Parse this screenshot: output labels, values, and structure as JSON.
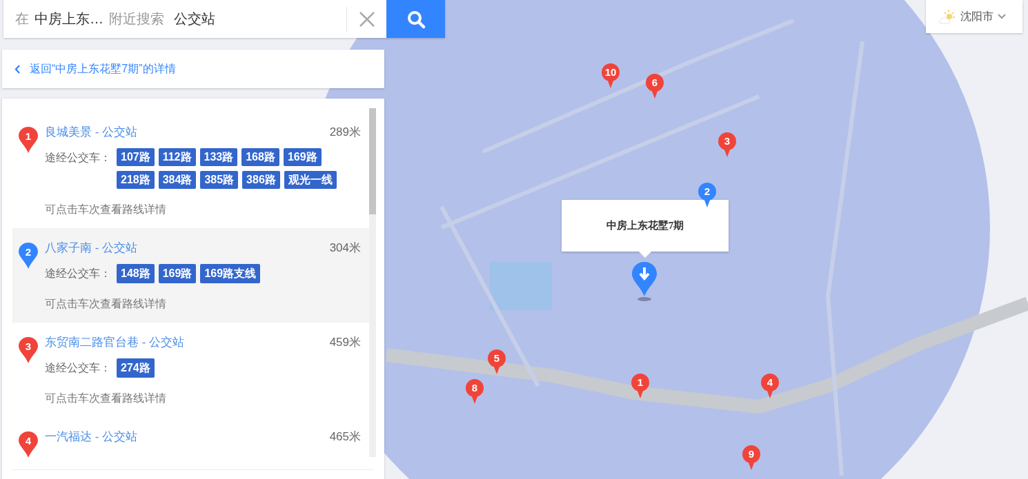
{
  "search": {
    "prefix": "在",
    "place": "中房上东…",
    "suffix": "附近搜索",
    "value": "公交站"
  },
  "back_link": "返回“中房上东花墅7期”的详情",
  "results": [
    {
      "index": "1",
      "name": "良城美景 - 公交站",
      "distance": "289米",
      "routes_label": "途经公交车：",
      "routes": [
        "107路",
        "112路",
        "133路",
        "168路",
        "169路",
        "218路",
        "384路",
        "385路",
        "386路",
        "观光一线"
      ],
      "hint": "可点击车次查看路线详情",
      "selected": false
    },
    {
      "index": "2",
      "name": "八家子南 - 公交站",
      "distance": "304米",
      "routes_label": "途经公交车：",
      "routes": [
        "148路",
        "169路",
        "169路支线"
      ],
      "hint": "可点击车次查看路线详情",
      "selected": true
    },
    {
      "index": "3",
      "name": "东贸南二路官台巷 - 公交站",
      "distance": "459米",
      "routes_label": "途经公交车：",
      "routes": [
        "274路"
      ],
      "hint": "可点击车次查看路线详情",
      "selected": false
    },
    {
      "index": "4",
      "name": "一汽福达 - 公交站",
      "distance": "465米",
      "selected": false
    }
  ],
  "city": "沈阳市",
  "map": {
    "popup": "中房上东花墅7期",
    "pins": [
      {
        "label": "1",
        "selected": false
      },
      {
        "label": "2",
        "selected": true
      },
      {
        "label": "3",
        "selected": false
      },
      {
        "label": "4",
        "selected": false
      },
      {
        "label": "5",
        "selected": false
      },
      {
        "label": "6",
        "selected": false
      },
      {
        "label": "8",
        "selected": false
      },
      {
        "label": "9",
        "selected": false
      },
      {
        "label": "10",
        "selected": false
      }
    ]
  }
}
